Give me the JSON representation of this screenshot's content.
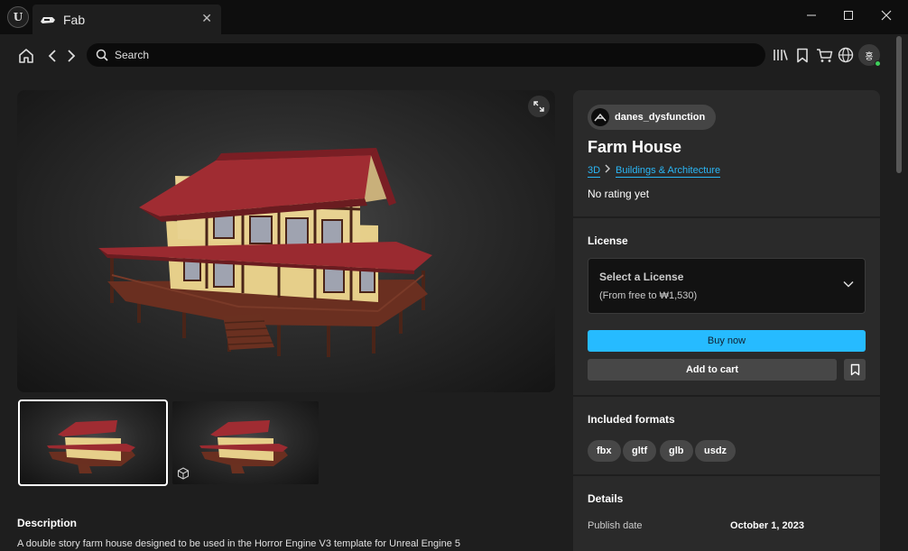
{
  "window": {
    "tab_title": "Fab",
    "tab_close": "✕",
    "minimize": "—",
    "maximize": "☐",
    "close": "✕",
    "app_logo_icon": "unreal-logo-icon"
  },
  "nav": {
    "search_placeholder": "Search",
    "avatar_initials": "홍"
  },
  "product": {
    "creator": "danes_dysfunction",
    "title": "Farm House",
    "breadcrumb": [
      "3D",
      "Buildings & Architecture"
    ],
    "rating": "No rating yet"
  },
  "license": {
    "section_title": "License",
    "select_label": "Select a License",
    "price_range": "(From free to ₩1,530)",
    "buy_label": "Buy now",
    "cart_label": "Add to cart"
  },
  "formats": {
    "section_title": "Included formats",
    "items": [
      "fbx",
      "gltf",
      "glb",
      "usdz"
    ]
  },
  "details": {
    "section_title": "Details",
    "publish_label": "Publish date",
    "publish_value": "October 1, 2023"
  },
  "description": {
    "title": "Description",
    "text": "A double story farm house designed to be used in the Horror Engine V3 template for Unreal Engine 5"
  },
  "colors": {
    "accent": "#26bbff",
    "online": "#3ecf5b"
  }
}
